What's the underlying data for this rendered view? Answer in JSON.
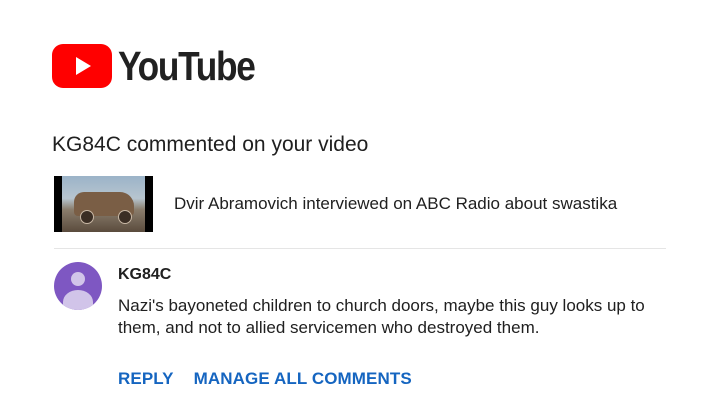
{
  "brand": {
    "logo_icon": "youtube-play-icon",
    "wordmark": "YouTube",
    "colors": {
      "red": "#ff0000",
      "text": "#212121"
    }
  },
  "notification": {
    "headline": "KG84C commented on your video"
  },
  "video": {
    "thumbnail_icon": "video-thumbnail",
    "title": "Dvir Abramovich interviewed on ABC Radio about swastika"
  },
  "comment": {
    "avatar_icon": "person-avatar-icon",
    "author": "KG84C",
    "text": "Nazi's bayoneted children to church doors, maybe this guy looks up to them, and not to allied servicemen who destroyed them."
  },
  "actions": {
    "reply": "REPLY",
    "manage": "MANAGE ALL COMMENTS",
    "color": "#1565c0"
  }
}
